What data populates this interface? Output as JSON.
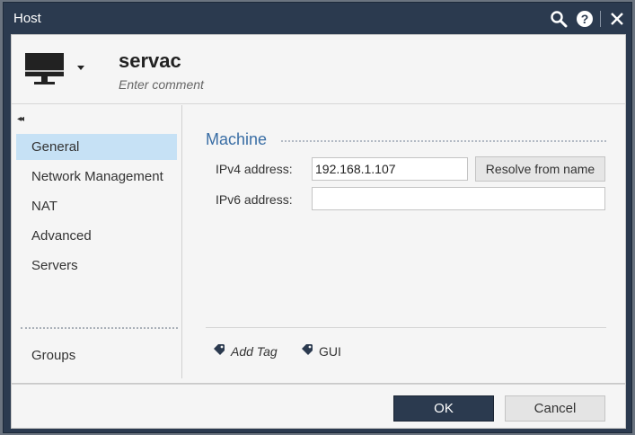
{
  "window": {
    "title": "Host",
    "icons": [
      "search-icon",
      "help-icon",
      "close-icon"
    ]
  },
  "header": {
    "host_name": "servac",
    "comment_placeholder": "Enter comment",
    "host_type_icon": "monitor-icon"
  },
  "sidebar": {
    "collapse_glyph": "◂◂",
    "items": [
      {
        "label": "General",
        "active": true
      },
      {
        "label": "Network Management",
        "active": false
      },
      {
        "label": "NAT",
        "active": false
      },
      {
        "label": "Advanced",
        "active": false
      },
      {
        "label": "Servers",
        "active": false
      }
    ],
    "groups_label": "Groups"
  },
  "main": {
    "section_title": "Machine",
    "ipv4": {
      "label": "IPv4 address:",
      "value": "192.168.1.107"
    },
    "ipv6": {
      "label": "IPv6 address:",
      "value": ""
    },
    "resolve_label": "Resolve from name",
    "tags": [
      {
        "label": "Add Tag",
        "icon": "tag-icon"
      },
      {
        "label": "GUI",
        "icon": "tag-icon"
      }
    ]
  },
  "footer": {
    "ok_label": "OK",
    "cancel_label": "Cancel"
  },
  "colors": {
    "titlebar": "#2b3a4f",
    "accent": "#3a6ea5",
    "selected_nav": "#c6e1f5"
  }
}
